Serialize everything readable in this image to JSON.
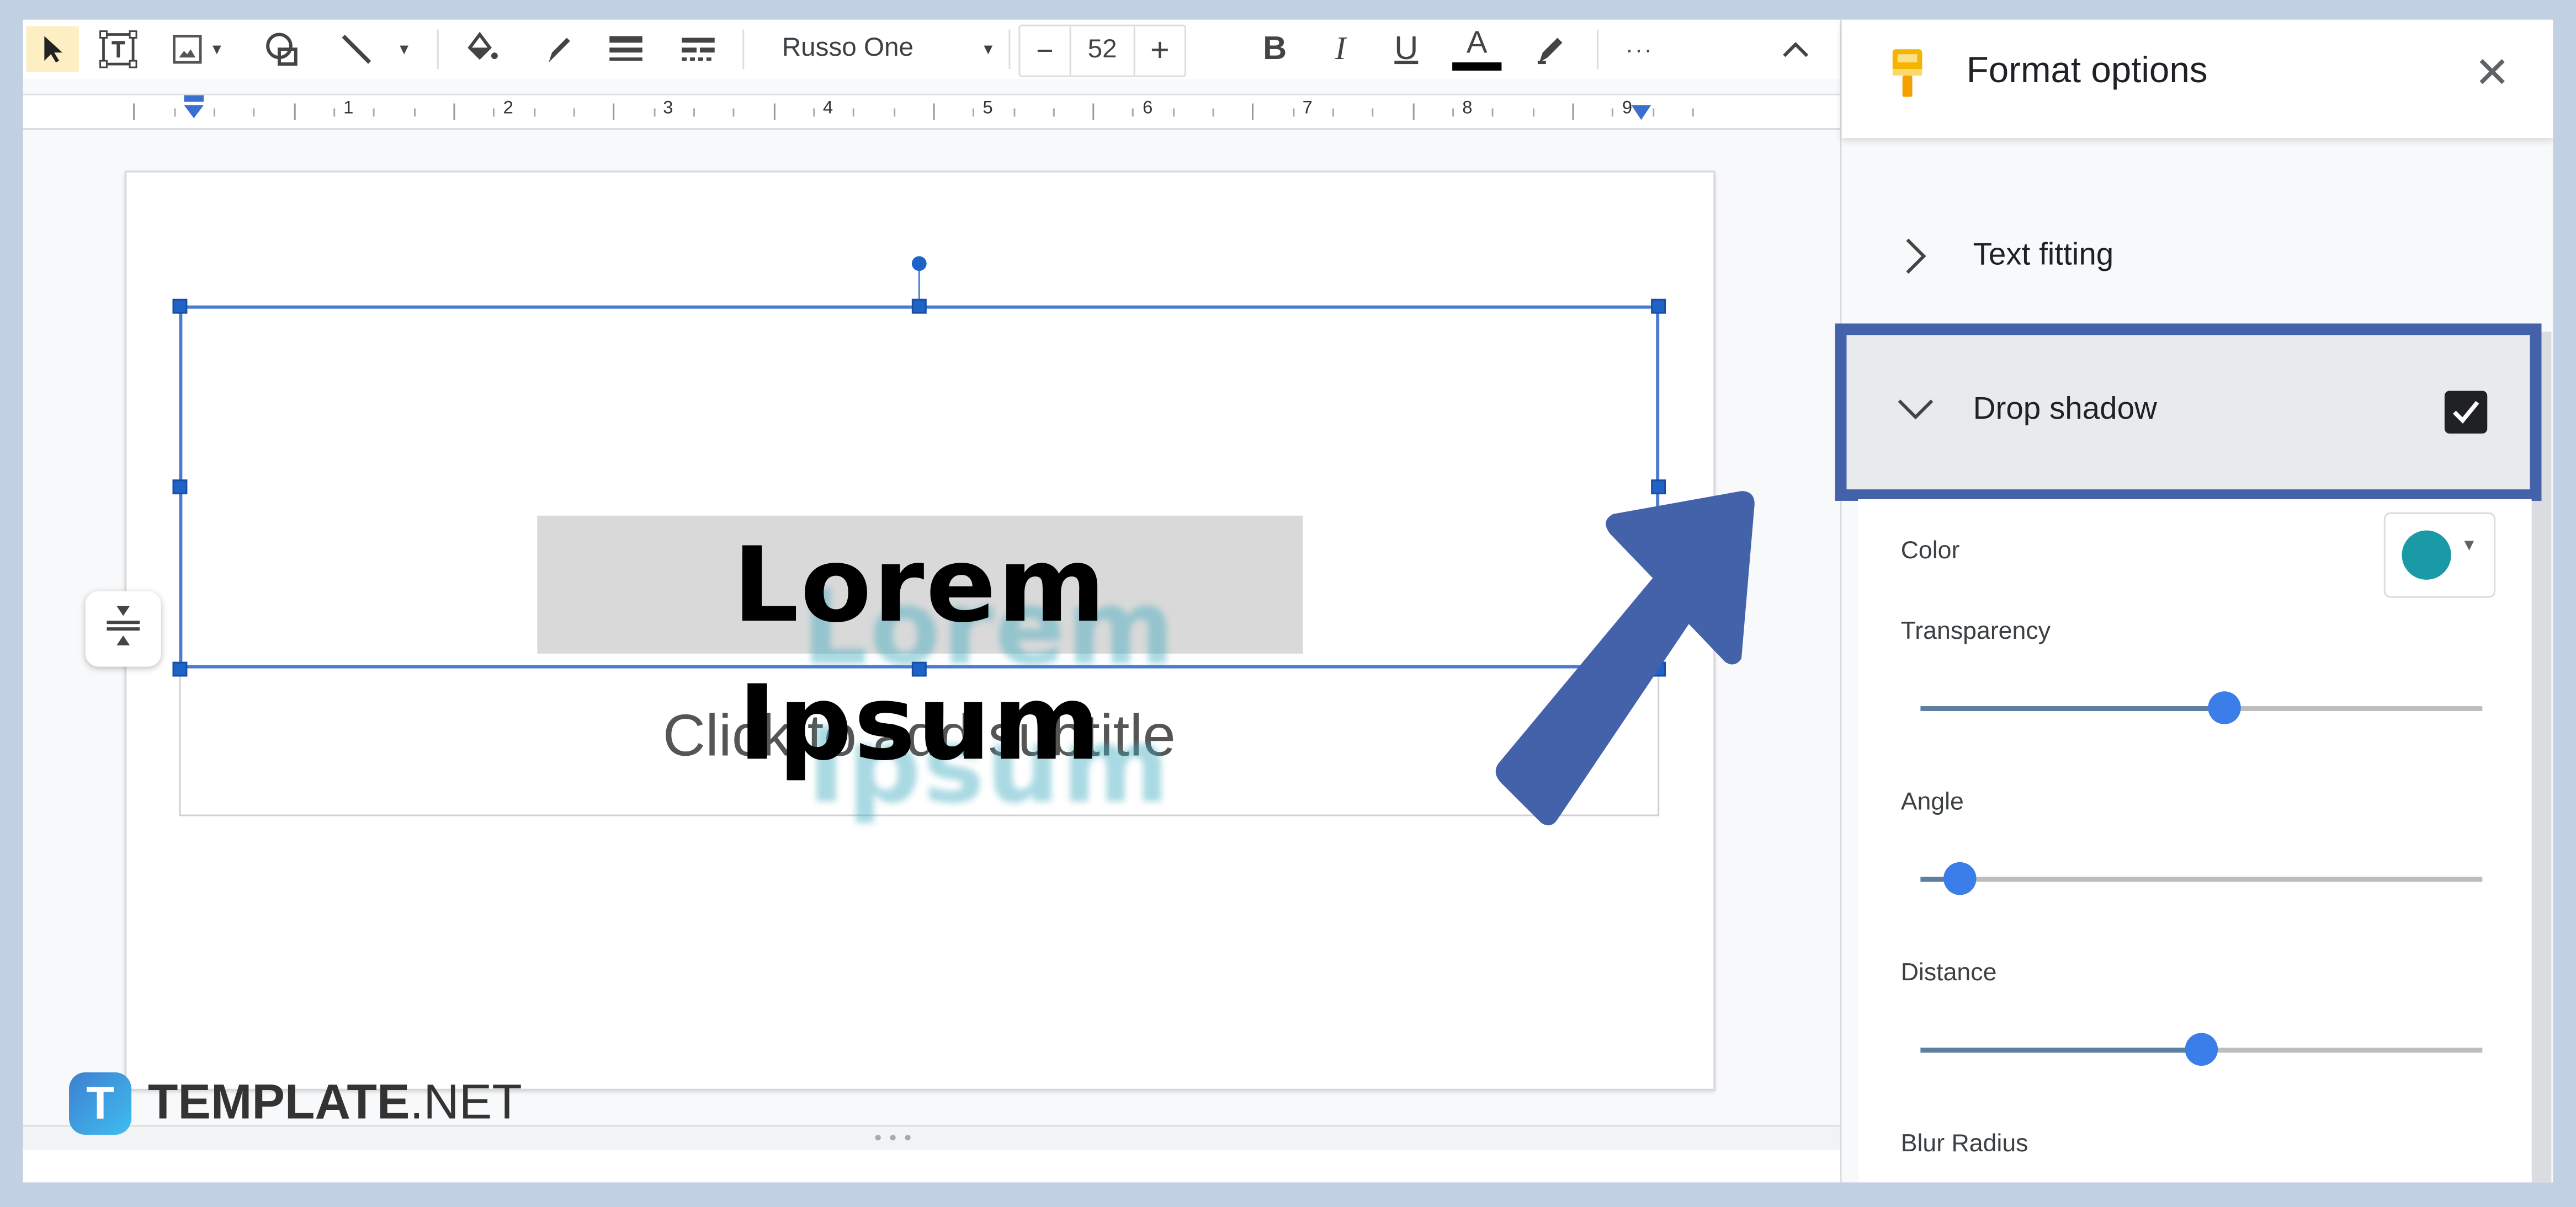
{
  "toolbar": {
    "tools": [
      {
        "name": "select-tool",
        "icon": "cursor-arrow",
        "active": true
      },
      {
        "name": "text-box-tool",
        "icon": "text-box"
      },
      {
        "name": "image-tool",
        "icon": "image"
      },
      {
        "name": "shape-tool",
        "icon": "shape"
      },
      {
        "name": "line-tool",
        "icon": "line"
      },
      {
        "name": "fill-color",
        "icon": "paint-bucket"
      },
      {
        "name": "border-color",
        "icon": "pencil"
      },
      {
        "name": "border-weight",
        "icon": "border-weight"
      },
      {
        "name": "border-dash",
        "icon": "border-dash"
      }
    ],
    "font_name": "Russo One",
    "font_size": "52",
    "decrease_label": "−",
    "increase_label": "+",
    "bold_label": "B",
    "italic_label": "I",
    "underline_label": "U",
    "text_color_label": "A",
    "more_label": "···",
    "text_color": "#000000"
  },
  "ruler": {
    "numbers": [
      "1",
      "2",
      "3",
      "4",
      "5",
      "6",
      "7",
      "8",
      "9"
    ]
  },
  "slide": {
    "title": "Lorem Ipsum",
    "subtitle_placeholder": "Click to add subtitle"
  },
  "panel": {
    "title": "Format options",
    "close_label": "✕",
    "sections": {
      "text_fitting": {
        "label": "Text fitting",
        "expanded": false
      },
      "drop_shadow": {
        "label": "Drop shadow",
        "expanded": true,
        "checked": true
      }
    },
    "drop_shadow": {
      "color_label": "Color",
      "color_value": "#1a9aa6",
      "transparency_label": "Transparency",
      "transparency": 0.54,
      "angle_label": "Angle",
      "angle": 0.07,
      "distance_label": "Distance",
      "distance": 0.5,
      "blur_radius_label": "Blur Radius"
    }
  },
  "watermark": {
    "brand": "TEMPLATE",
    "suffix": ".NET",
    "badge_letter": "T"
  },
  "colors": {
    "highlight_frame": "#4462aa",
    "selection_blue": "#4a7bd0",
    "slider_thumb": "#3b7de9",
    "format_icon": "#f4b400"
  }
}
